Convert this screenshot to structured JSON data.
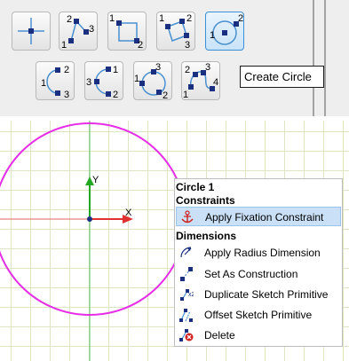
{
  "toolbar": {
    "tooltip": "Create Circle",
    "row1": [
      {
        "icon": "point-icon",
        "labels": []
      },
      {
        "icon": "polyline-icon",
        "labels": [
          "1",
          "2",
          "3"
        ]
      },
      {
        "icon": "rectangle-corner-icon",
        "labels": [
          "1",
          "2"
        ]
      },
      {
        "icon": "rectangle-3point-icon",
        "labels": [
          "1",
          "2",
          "3"
        ]
      },
      {
        "icon": "circle-center-icon",
        "labels": [
          "1",
          "2"
        ]
      }
    ],
    "row2": [
      {
        "icon": "arc-3point-icon",
        "labels": [
          "1",
          "2",
          "3"
        ]
      },
      {
        "icon": "arc-center-icon",
        "labels": [
          "1",
          "2",
          "3"
        ]
      },
      {
        "icon": "circle-3point-icon",
        "labels": [
          "1",
          "2",
          "3"
        ]
      },
      {
        "icon": "spline-icon",
        "labels": [
          "1",
          "2",
          "3",
          "4"
        ]
      }
    ]
  },
  "canvas": {
    "axis_x_label": "X",
    "axis_y_label": "Y",
    "colors": {
      "circle": "#e62ee6",
      "x_axis": "#e06060",
      "y_axis": "#5cc05c",
      "grid": "#dde5c2"
    }
  },
  "context_menu": {
    "title": "Circle 1",
    "section_constraints": "Constraints",
    "section_dimensions": "Dimensions",
    "items": [
      {
        "label": "Apply Fixation Constraint",
        "icon": "anchor-icon"
      },
      {
        "label": "Apply Radius Dimension",
        "icon": "radius-dimension-icon"
      },
      {
        "label": "Set As Construction",
        "icon": "construction-icon"
      },
      {
        "label": "Duplicate Sketch Primitive",
        "icon": "duplicate-icon"
      },
      {
        "label": "Offset Sketch Primitive",
        "icon": "offset-icon"
      },
      {
        "label": "Delete",
        "icon": "delete-icon"
      }
    ],
    "hover_index": 0
  }
}
